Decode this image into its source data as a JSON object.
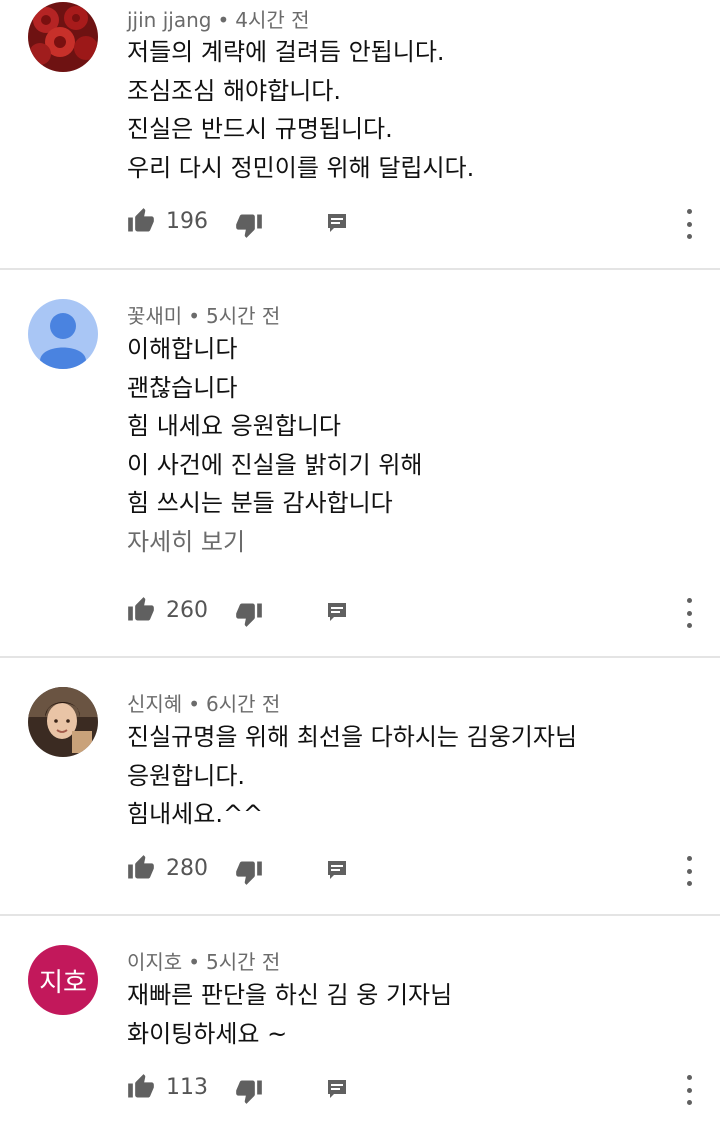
{
  "colors": {
    "text": "#111111",
    "meta": "#6b6b6b",
    "icon": "#606060",
    "divider": "#e4e4e4"
  },
  "comments": [
    {
      "author": "jjin jjang",
      "time": "4시간 전",
      "avatar_icon": "rose-photo-avatar",
      "lines": [
        "저들의 계략에 걸려듬 안됩니다.",
        "조심조심 해야합니다.",
        "진실은 반드시 규명됩니다.",
        "우리 다시 정민이를 위해 달립시다."
      ],
      "likes": "196"
    },
    {
      "author": "꽃새미",
      "time": "5시간 전",
      "avatar_icon": "default-person-avatar",
      "lines": [
        "이해합니다",
        "괜찮습니다",
        "힘 내세요 응원합니다",
        "이 사건에 진실을 밝히기 위해",
        "힘 쓰시는 분들 감사합니다"
      ],
      "read_more": "자세히 보기",
      "likes": "260"
    },
    {
      "author": "신지혜",
      "time": "6시간 전",
      "avatar_icon": "person-photo-avatar",
      "lines": [
        "진실규명을 위해 최선을 다하시는 김웅기자님",
        "응원합니다.",
        "힘내세요.^^"
      ],
      "likes": "280"
    },
    {
      "author": "이지호",
      "time": "5시간 전",
      "avatar_text": "지호",
      "avatar_color": "#c2185b",
      "lines": [
        "재빠른 판단을 하신 김 웅 기자님",
        "화이팅하세요 ~"
      ],
      "likes": "113"
    }
  ]
}
